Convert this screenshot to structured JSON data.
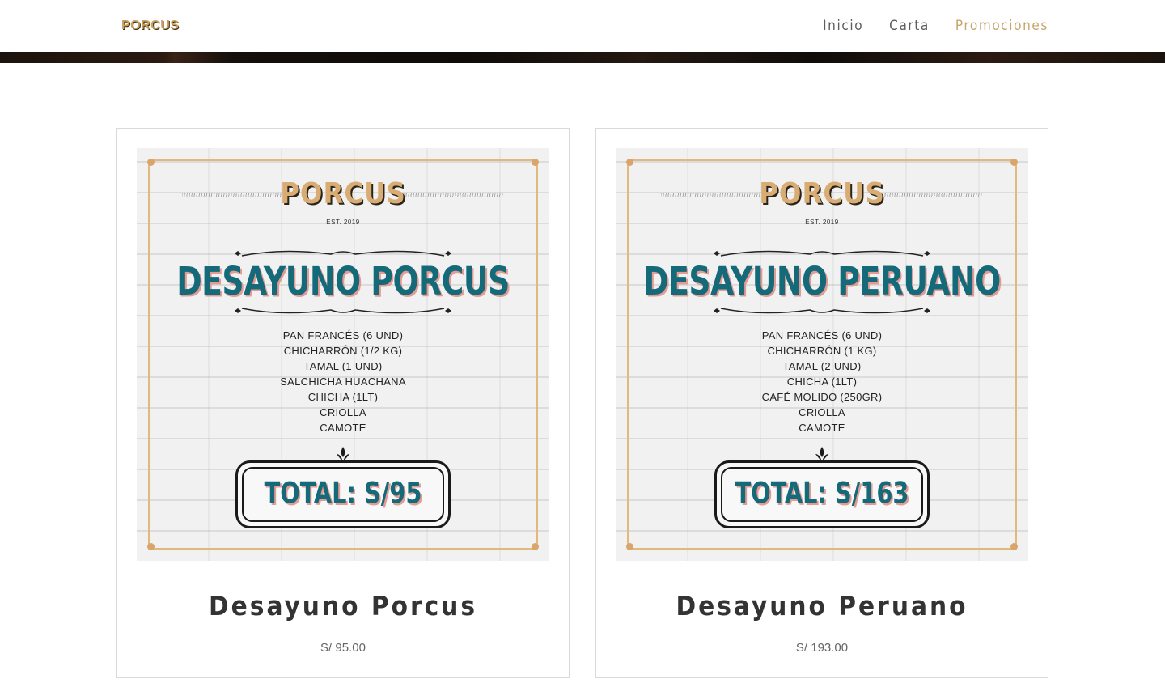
{
  "brand": {
    "logo_text": "PORCUS"
  },
  "nav": {
    "items": [
      {
        "label": "Inicio"
      },
      {
        "label": "Carta"
      },
      {
        "label": "Promociones"
      }
    ]
  },
  "colors": {
    "accent": "#c9a46a",
    "poster_title": "#146a78",
    "poster_shadow": "#e39b94"
  },
  "products": [
    {
      "poster": {
        "brand": "PORCUS",
        "est": "EST. 2019",
        "title": "DESAYUNO PORCUS",
        "items": [
          "PAN FRANCÉS (6 UND)",
          "CHICHARRÓN (1/2 KG)",
          "TAMAL (1 UND)",
          "SALCHICHA HUACHANA",
          "CHICHA (1LT)",
          "CRIOLLA",
          "CAMOTE"
        ],
        "total": "TOTAL: S/95"
      },
      "name": "Desayuno Porcus",
      "price": "S/ 95.00"
    },
    {
      "poster": {
        "brand": "PORCUS",
        "est": "EST. 2019",
        "title": "DESAYUNO PERUANO",
        "items": [
          "PAN FRANCÉS (6 UND)",
          "CHICHARRÓN (1 KG)",
          "TAMAL (2 UND)",
          "CHICHA (1LT)",
          "CAFÉ MOLIDO (250GR)",
          "CRIOLLA",
          "CAMOTE"
        ],
        "total": "TOTAL: S/163"
      },
      "name": "Desayuno Peruano",
      "price": "S/ 193.00"
    }
  ]
}
